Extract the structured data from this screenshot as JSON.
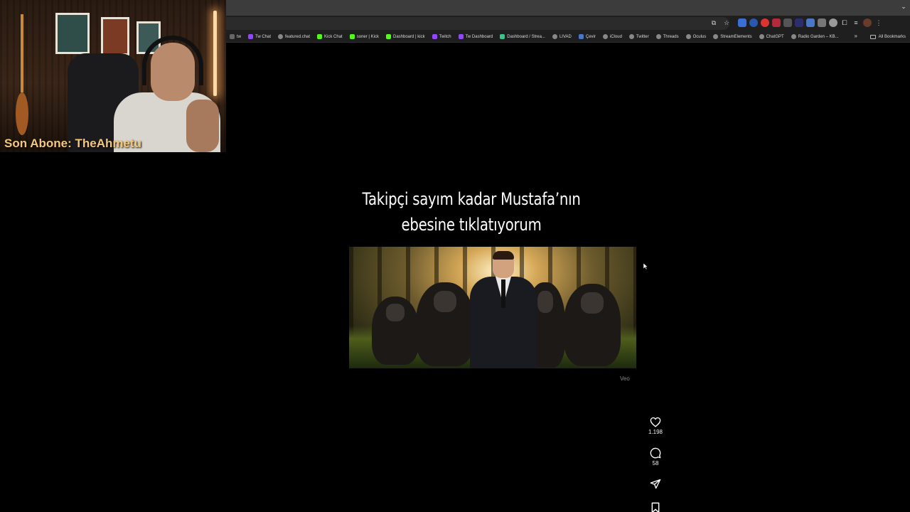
{
  "webcam": {
    "subscriber_label": "Son Abone: TheAhmetu"
  },
  "bookmarks": {
    "items": [
      {
        "label": "tw",
        "icon": "globe-icon"
      },
      {
        "label": "Tw Chat",
        "icon": "twitch-icon"
      },
      {
        "label": "featured.chat",
        "icon": "globe-icon"
      },
      {
        "label": "Kick Chat",
        "icon": "kick-icon"
      },
      {
        "label": "soner | Kick",
        "icon": "kick-icon"
      },
      {
        "label": "Dashboard | kick",
        "icon": "kick-icon"
      },
      {
        "label": "Twitch",
        "icon": "twitch-icon"
      },
      {
        "label": "Tw Dashboard",
        "icon": "twitch-icon"
      },
      {
        "label": "Dashboard / Strea...",
        "icon": "streamelements-icon"
      },
      {
        "label": "LIVAD",
        "icon": "globe-icon"
      },
      {
        "label": "Çevir",
        "icon": "translate-icon"
      },
      {
        "label": "iCloud",
        "icon": "globe-icon"
      },
      {
        "label": "Twitter",
        "icon": "globe-icon"
      },
      {
        "label": "Threads",
        "icon": "globe-icon"
      },
      {
        "label": "Oculus",
        "icon": "globe-icon"
      },
      {
        "label": "StreamElements",
        "icon": "globe-icon"
      },
      {
        "label": "ChatGPT",
        "icon": "globe-icon"
      },
      {
        "label": "Radio Garden – KB...",
        "icon": "globe-icon"
      }
    ],
    "overflow": "»",
    "all_bookmarks": "All Bookmarks"
  },
  "post": {
    "title_line1": "Takipçi sayım kadar Mustafa’nın",
    "title_line2": "ebesine tıklatıyorum",
    "watermark": "Veo",
    "likes": "1.198",
    "comments": "58"
  },
  "colors": {
    "background": "#000000",
    "subscriber_label": "#f4c77a",
    "chrome_dark": "#1f1f1f"
  }
}
